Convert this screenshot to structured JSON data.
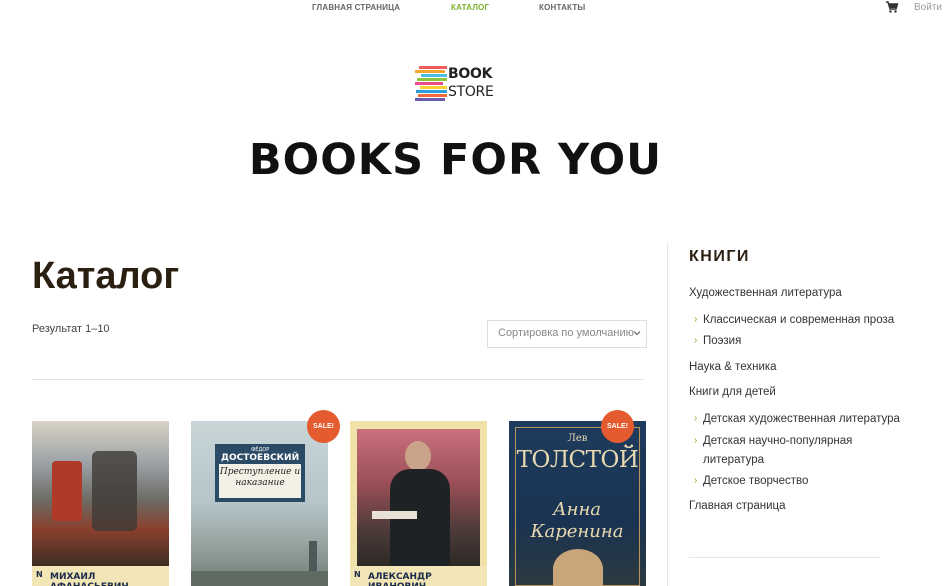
{
  "nav": {
    "items": [
      {
        "label": "ГЛАВНАЯ СТРАНИЦА",
        "active": false
      },
      {
        "label": "КАТАЛОГ",
        "active": true
      },
      {
        "label": "КОНТАКТЫ",
        "active": false
      }
    ],
    "login": "Войти",
    "cart_icon": "cart-icon"
  },
  "logo": {
    "line1": "BOOK",
    "line2": "STORE"
  },
  "hero_title": "BOOKS FOR YOU",
  "catalog": {
    "heading": "Каталог",
    "results": "Результат 1–10",
    "sort_selected": "Сортировка по умолчанию"
  },
  "sidebar": {
    "title": "КНИГИ",
    "categories": [
      {
        "label": "Художественная литература",
        "level": 0
      },
      {
        "label": "Классическая и современная проза",
        "level": 1
      },
      {
        "label": "Поэзия",
        "level": 1
      },
      {
        "label": "Наука & техника",
        "level": 0
      },
      {
        "label": "Книги для детей",
        "level": 0
      },
      {
        "label": "Детская художественная литература",
        "level": 1
      },
      {
        "label": "Детская научно-популярная",
        "level": 1
      },
      {
        "label": "литература",
        "level": 1
      },
      {
        "label": "Детское творчество",
        "level": 1
      },
      {
        "label": "Главная страница",
        "level": 0
      }
    ]
  },
  "products": [
    {
      "author": "МИХАИЛ АФАНАСЬЕВИЧ",
      "publisher_mark": "N",
      "sale": false
    },
    {
      "author": "ФЁДОР ДОСТОЕВСКИЙ",
      "author_small": "ФЁДОР",
      "author_big": "ДОСТОЕВСКИЙ",
      "title": "Преступление и наказание",
      "sale": true,
      "sale_label": "SALE!"
    },
    {
      "author": "АЛЕКСАНДР ИВАНОВИЧ",
      "publisher_mark": "N",
      "sale": false
    },
    {
      "author": "Лев ТОЛСТОЙ",
      "author_small": "Лев",
      "author_big": "ТОЛСТОЙ",
      "title": "Анна Каренина",
      "sale": true,
      "sale_label": "SALE!"
    }
  ],
  "colors": {
    "accent": "#7bb02a",
    "sale": "#e35b2e",
    "heading": "#2b1f12"
  }
}
